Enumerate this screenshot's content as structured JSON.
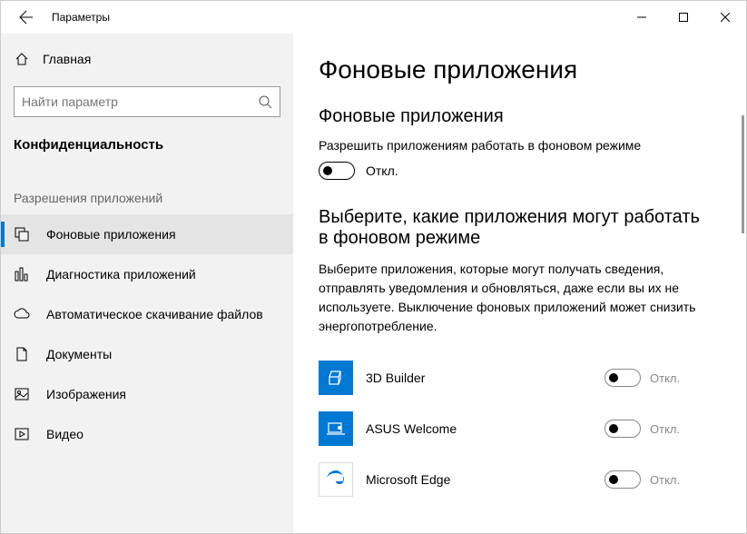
{
  "window": {
    "title": "Параметры"
  },
  "sidebar": {
    "home_label": "Главная",
    "search_placeholder": "Найти параметр",
    "category_label": "Конфиденциальность",
    "section_label": "Разрешения приложений",
    "items": [
      {
        "label": "Фоновые приложения"
      },
      {
        "label": "Диагностика приложений"
      },
      {
        "label": "Автоматическое скачивание файлов"
      },
      {
        "label": "Документы"
      },
      {
        "label": "Изображения"
      },
      {
        "label": "Видео"
      }
    ]
  },
  "main": {
    "page_title": "Фоновые приложения",
    "section1_title": "Фоновые приложения",
    "allow_label": "Разрешить приложениям работать в фоновом режиме",
    "toggle_state_off": "Откл.",
    "section2_title": "Выберите, какие приложения могут работать в фоновом режиме",
    "description": "Выберите приложения, которые могут получать сведения, отправлять уведомления и обновляться, даже если вы их не используете. Выключение фоновых приложений может снизить энергопотребление.",
    "apps": [
      {
        "name": "3D Builder",
        "state": "Откл."
      },
      {
        "name": "ASUS Welcome",
        "state": "Откл."
      },
      {
        "name": "Microsoft Edge",
        "state": "Откл."
      }
    ]
  }
}
